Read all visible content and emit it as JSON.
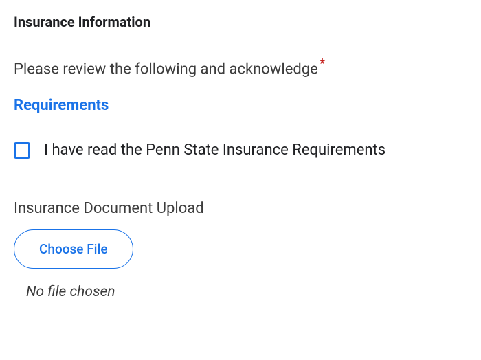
{
  "section": {
    "title": "Insurance Information"
  },
  "acknowledge": {
    "prompt": "Please review the following and acknowledge",
    "required_marker": "*",
    "requirements_link_label": "Requirements",
    "checkbox_label": "I have read the Penn State Insurance Requirements"
  },
  "upload": {
    "label": "Insurance Document Upload",
    "button_label": "Choose File",
    "status": "No file chosen"
  }
}
